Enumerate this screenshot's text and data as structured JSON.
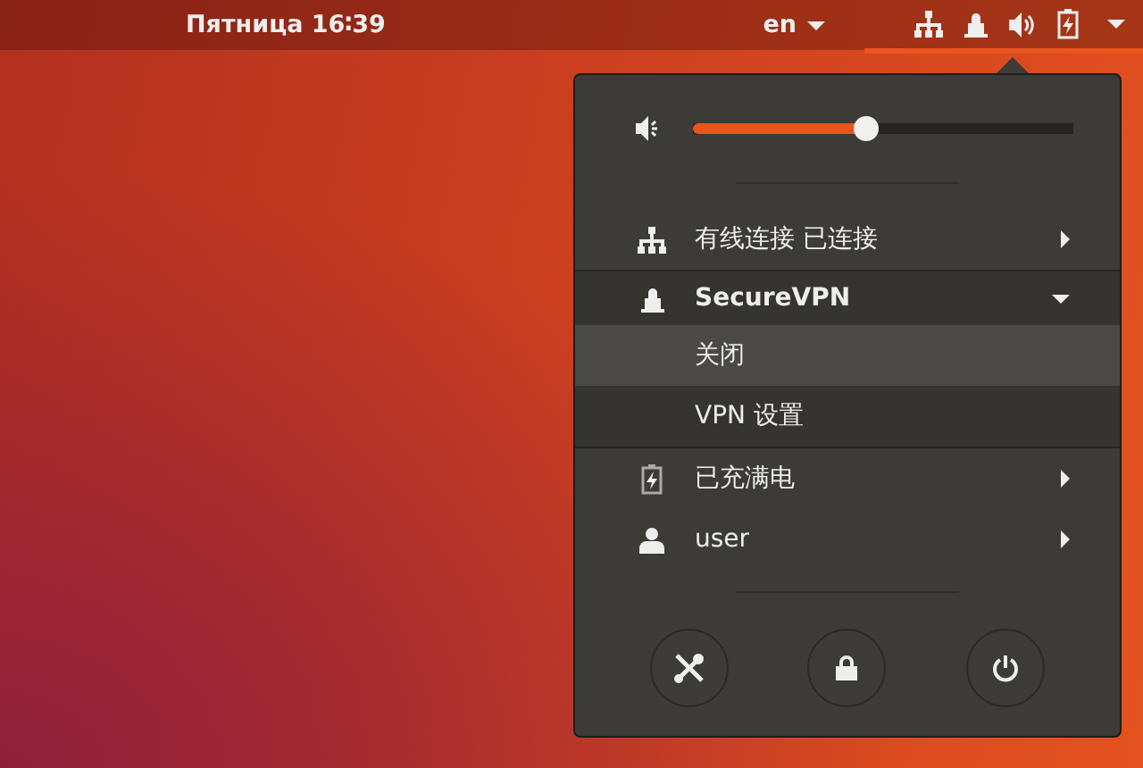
{
  "top_bar": {
    "clock": "Пятница 16∶39",
    "language": "en"
  },
  "menu": {
    "volume": {
      "level": 0.45
    },
    "items": [
      {
        "kind": "row",
        "label": "有线连接 已连接",
        "expanded": false
      },
      {
        "kind": "section",
        "label": "SecureVPN",
        "expanded": true,
        "children": [
          {
            "label": "关闭",
            "selected": true
          },
          {
            "label": "VPN 设置",
            "selected": false
          }
        ]
      },
      {
        "kind": "row",
        "label": "已充满电",
        "expanded": false
      },
      {
        "kind": "row",
        "label": "user",
        "expanded": false
      }
    ]
  }
}
